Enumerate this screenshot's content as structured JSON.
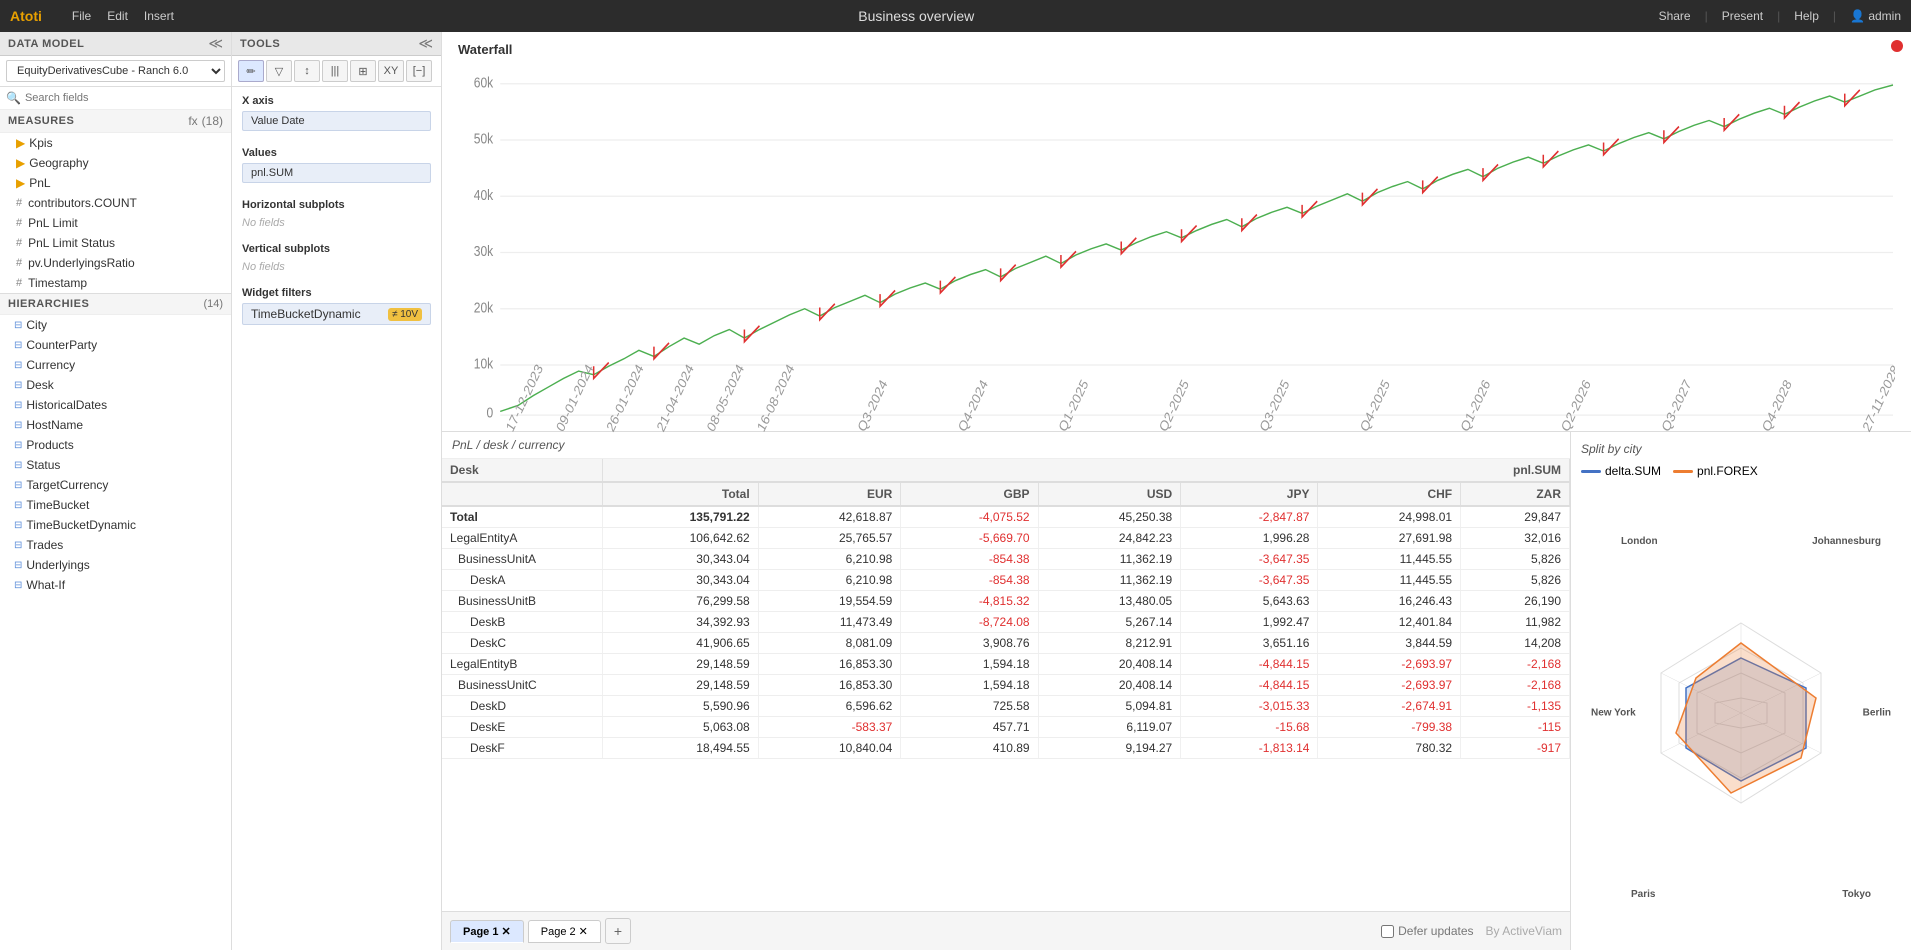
{
  "app": {
    "brand": "Atoti",
    "menu": [
      "File",
      "Edit",
      "Insert"
    ],
    "title": "Business overview",
    "actions": [
      "Share",
      "Present",
      "Help",
      "admin"
    ]
  },
  "left_panel": {
    "data_model_title": "DATA MODEL",
    "cube_name": "EquityDerivativesCube - Ranch 6.0",
    "search_placeholder": "Search fields",
    "measures_title": "MEASURES",
    "measures_count": "(18)",
    "measures": [
      {
        "type": "folder",
        "label": "Kpis"
      },
      {
        "type": "folder",
        "label": "Geography"
      },
      {
        "type": "folder",
        "label": "PnL"
      },
      {
        "type": "hash",
        "label": "contributors.COUNT"
      },
      {
        "type": "hash",
        "label": "PnL Limit"
      },
      {
        "type": "hash",
        "label": "PnL Limit Status"
      },
      {
        "type": "hash",
        "label": "pv.UnderlyingsRatio"
      },
      {
        "type": "hash",
        "label": "Timestamp"
      }
    ],
    "hierarchies_title": "HIERARCHIES",
    "hierarchies_count": "(14)",
    "hierarchies": [
      "City",
      "CounterParty",
      "Currency",
      "Desk",
      "HistoricalDates",
      "HostName",
      "Products",
      "Status",
      "TargetCurrency",
      "TimeBucket",
      "TimeBucketDynamic",
      "Trades",
      "Underlyings",
      "What-If"
    ]
  },
  "tools_panel": {
    "title": "TOOLS",
    "x_axis_label": "X axis",
    "x_axis_field": "Value Date",
    "values_label": "Values",
    "values_field": "pnl.SUM",
    "horizontal_subplots_label": "Horizontal subplots",
    "horizontal_no_fields": "No fields",
    "vertical_subplots_label": "Vertical subplots",
    "vertical_no_fields": "No fields",
    "widget_filters_label": "Widget filters",
    "filter_field": "TimeBucketDynamic",
    "filter_badge": "≠ 10V"
  },
  "chart": {
    "title": "Waterfall",
    "y_labels": [
      "60k",
      "50k",
      "40k",
      "30k",
      "20k",
      "10k",
      "0"
    ]
  },
  "table": {
    "title": "PnL / desk / currency",
    "columns": [
      "Desk",
      "pnl.SUM",
      "",
      "",
      "",
      "",
      "",
      ""
    ],
    "sub_columns": [
      "",
      "Total",
      "EUR",
      "GBP",
      "USD",
      "JPY",
      "CHF",
      "ZAR"
    ],
    "rows": [
      {
        "label": "Total",
        "indent": 0,
        "total": "135,791.22",
        "eur": "42,618.87",
        "gbp": "-4,075.52",
        "usd": "45,250.38",
        "jpy": "-2,847.87",
        "chf": "24,998.01",
        "zar": "29,847"
      },
      {
        "label": "LegalEntityA",
        "indent": 1,
        "total": "106,642.62",
        "eur": "25,765.57",
        "gbp": "-5,669.70",
        "usd": "24,842.23",
        "jpy": "1,996.28",
        "chf": "27,691.98",
        "zar": "32,016"
      },
      {
        "label": "BusinessUnitA",
        "indent": 2,
        "total": "30,343.04",
        "eur": "6,210.98",
        "gbp": "-854.38",
        "usd": "11,362.19",
        "jpy": "-3,647.35",
        "chf": "11,445.55",
        "zar": "5,826"
      },
      {
        "label": "DeskA",
        "indent": 3,
        "total": "30,343.04",
        "eur": "6,210.98",
        "gbp": "-854.38",
        "usd": "11,362.19",
        "jpy": "-3,647.35",
        "chf": "11,445.55",
        "zar": "5,826"
      },
      {
        "label": "BusinessUnitB",
        "indent": 2,
        "total": "76,299.58",
        "eur": "19,554.59",
        "gbp": "-4,815.32",
        "usd": "13,480.05",
        "jpy": "5,643.63",
        "chf": "16,246.43",
        "zar": "26,190"
      },
      {
        "label": "DeskB",
        "indent": 3,
        "total": "34,392.93",
        "eur": "11,473.49",
        "gbp": "-8,724.08",
        "usd": "5,267.14",
        "jpy": "1,992.47",
        "chf": "12,401.84",
        "zar": "11,982"
      },
      {
        "label": "DeskC",
        "indent": 3,
        "total": "41,906.65",
        "eur": "8,081.09",
        "gbp": "3,908.76",
        "usd": "8,212.91",
        "jpy": "3,651.16",
        "chf": "3,844.59",
        "zar": "14,208"
      },
      {
        "label": "LegalEntityB",
        "indent": 1,
        "total": "29,148.59",
        "eur": "16,853.30",
        "gbp": "1,594.18",
        "usd": "20,408.14",
        "jpy": "-4,844.15",
        "chf": "-2,693.97",
        "zar": "-2,168"
      },
      {
        "label": "BusinessUnitC",
        "indent": 2,
        "total": "29,148.59",
        "eur": "16,853.30",
        "gbp": "1,594.18",
        "usd": "20,408.14",
        "jpy": "-4,844.15",
        "chf": "-2,693.97",
        "zar": "-2,168"
      },
      {
        "label": "DeskD",
        "indent": 3,
        "total": "5,590.96",
        "eur": "6,596.62",
        "gbp": "725.58",
        "usd": "5,094.81",
        "jpy": "-3,015.33",
        "chf": "-2,674.91",
        "zar": "-1,135"
      },
      {
        "label": "DeskE",
        "indent": 3,
        "total": "5,063.08",
        "eur": "-583.37",
        "gbp": "457.71",
        "usd": "6,119.07",
        "jpy": "-15.68",
        "chf": "-799.38",
        "zar": "-115"
      },
      {
        "label": "DeskF",
        "indent": 3,
        "total": "18,494.55",
        "eur": "10,840.04",
        "gbp": "410.89",
        "usd": "9,194.27",
        "jpy": "-1,813.14",
        "chf": "780.32",
        "zar": "-917"
      }
    ]
  },
  "radar": {
    "title": "Split by city",
    "legend": [
      {
        "label": "delta.SUM",
        "color": "#4472c4"
      },
      {
        "label": "pnl.FOREX",
        "color": "#ed7d31"
      }
    ],
    "cities": [
      "London",
      "Johannesburg",
      "New York",
      "Berlin",
      "Paris",
      "Tokyo"
    ]
  },
  "tabs": {
    "pages": [
      "Page 1",
      "Page 2"
    ],
    "add_label": "+",
    "defer_updates": "Defer updates",
    "by_label": "By ActiveViam"
  }
}
